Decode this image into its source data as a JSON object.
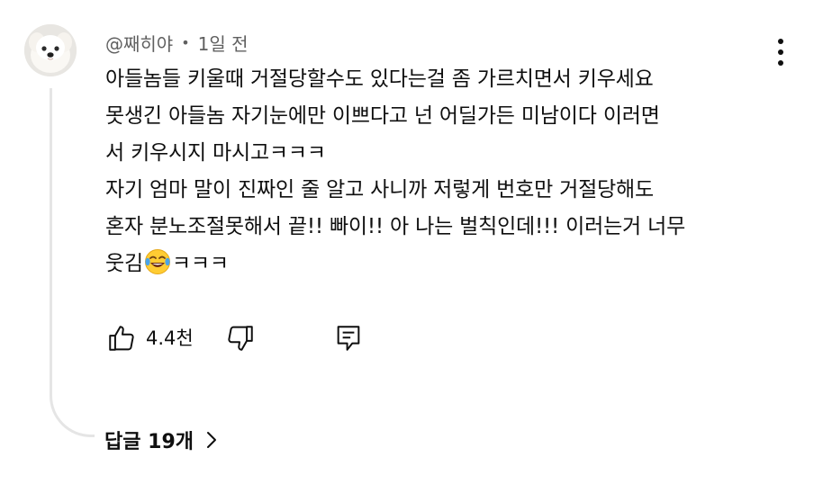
{
  "comment": {
    "author": "@째히야",
    "separator": "•",
    "time": "1일 전",
    "text_lines": [
      "아들놈들 키울때 거절당할수도 있다는걸 좀 가르치면서 키우세요",
      "못생긴 아들놈 자기눈에만 이쁘다고 넌 어딜가든 미남이다 이러면",
      "서 키우시지 마시고ㅋㅋㅋ",
      "자기 엄마 말이 진짜인 줄 알고 사니까 저렇게 번호만 거절당해도",
      "혼자 분노조절못해서 끝!! 빠이!! 아 나는 벌칙인데!!! 이러는거 너무"
    ],
    "last_line_before": "웃김",
    "last_line_emoji": "laughing-tears-emoji",
    "last_line_after": "ㅋㅋㅋ"
  },
  "actions": {
    "like_count": "4.4천",
    "like_icon": "thumbs-up-icon",
    "dislike_icon": "thumbs-down-icon",
    "reply_icon": "reply-comment-icon"
  },
  "replies": {
    "label": "답글 19개",
    "icon": "chevron-right-icon"
  },
  "menu_icon": "more-vertical-icon",
  "colors": {
    "text": "#0f0f0f",
    "secondary_text": "#606060",
    "thread_line": "#e5e5e5"
  }
}
